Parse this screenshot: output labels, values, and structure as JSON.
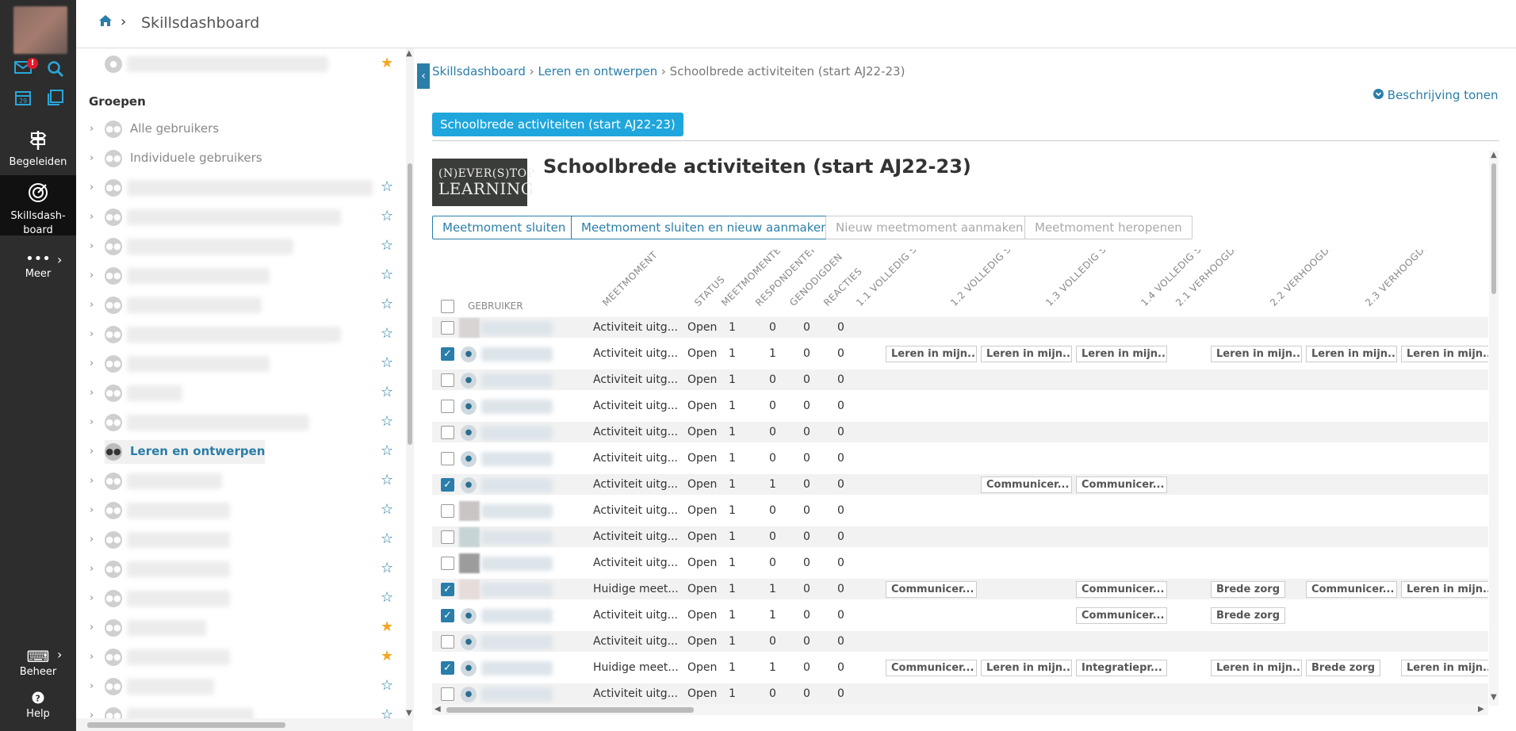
{
  "topbar": {
    "title": "Skillsdashboard"
  },
  "rail": {
    "badge": "!",
    "begeleiden": "Begeleiden",
    "skillsdashboard_1": "Skillsdash-",
    "skillsdashboard_2": "board",
    "meer": "Meer",
    "beheer": "Beheer",
    "help": "Help"
  },
  "groups": {
    "header": "Groepen",
    "items": [
      {
        "label": "Alle gebruikers"
      },
      {
        "label": "Individuele gebruikers"
      },
      {
        "label": "Leren en ontwerpen"
      }
    ]
  },
  "breadcrumb": {
    "item1": "Skillsdashboard",
    "item2": "Leren en ontwerpen",
    "current": "Schoolbrede activiteiten (start AJ22-23)"
  },
  "description_link": "Beschrijving tonen",
  "activity_pill": "Schoolbrede activiteiten (start AJ22-23)",
  "image_text": {
    "line1": "(N)EVER(S)TOP",
    "line2": "LEARNING"
  },
  "heading": "Schoolbrede activiteiten (start AJ22-23)",
  "buttons": {
    "close": "Meetmoment sluiten",
    "close_new": "Meetmoment sluiten en nieuw aanmaken",
    "new": "Nieuw meetmoment aanmaken",
    "reopen": "Meetmoment heropenen"
  },
  "table": {
    "user_header": "GEBRUIKER",
    "columns": [
      "MEETMOMENT",
      "STATUS",
      "MEETMOMENTEN",
      "RESPONDENTEN",
      "GENODIGDEN",
      "REACTIES",
      "1.1 VOLLEDIG SCH...",
      "1.2 VOLLEDIG SCH...",
      "1.3 VOLLEDIG SCH...",
      "1.4 VOLLEDIG SCH...",
      "2.1 VERHOOGDE Z...",
      "2.2 VERHOOGDE Z...",
      "2.3 VERHOOGDE Z..."
    ],
    "rows": [
      {
        "checked": false,
        "meetmoment": "Activiteit uitg...",
        "status": "Open",
        "m": "1",
        "r": "0",
        "g": "0",
        "re": "0",
        "tags": []
      },
      {
        "checked": true,
        "meetmoment": "Activiteit uitg...",
        "status": "Open",
        "m": "1",
        "r": "1",
        "g": "0",
        "re": "0",
        "tags": [
          "Leren in mijn...",
          "Leren in mijn...",
          "Leren in mijn...",
          "",
          "Leren in mijn...",
          "Leren in mijn...",
          "Leren in mijn..."
        ]
      },
      {
        "checked": false,
        "meetmoment": "Activiteit uitg...",
        "status": "Open",
        "m": "1",
        "r": "0",
        "g": "0",
        "re": "0",
        "tags": []
      },
      {
        "checked": false,
        "meetmoment": "Activiteit uitg...",
        "status": "Open",
        "m": "1",
        "r": "0",
        "g": "0",
        "re": "0",
        "tags": []
      },
      {
        "checked": false,
        "meetmoment": "Activiteit uitg...",
        "status": "Open",
        "m": "1",
        "r": "0",
        "g": "0",
        "re": "0",
        "tags": []
      },
      {
        "checked": false,
        "meetmoment": "Activiteit uitg...",
        "status": "Open",
        "m": "1",
        "r": "0",
        "g": "0",
        "re": "0",
        "tags": []
      },
      {
        "checked": true,
        "meetmoment": "Activiteit uitg...",
        "status": "Open",
        "m": "1",
        "r": "1",
        "g": "0",
        "re": "0",
        "tags": [
          "",
          "Communicer...",
          "Communicer...",
          "",
          "",
          "",
          ""
        ]
      },
      {
        "checked": false,
        "meetmoment": "Activiteit uitg...",
        "status": "Open",
        "m": "1",
        "r": "0",
        "g": "0",
        "re": "0",
        "tags": []
      },
      {
        "checked": false,
        "meetmoment": "Activiteit uitg...",
        "status": "Open",
        "m": "1",
        "r": "0",
        "g": "0",
        "re": "0",
        "tags": []
      },
      {
        "checked": false,
        "meetmoment": "Activiteit uitg...",
        "status": "Open",
        "m": "1",
        "r": "0",
        "g": "0",
        "re": "0",
        "tags": []
      },
      {
        "checked": true,
        "meetmoment": "Huidige meet...",
        "status": "Open",
        "m": "1",
        "r": "1",
        "g": "0",
        "re": "0",
        "tags": [
          "Communicer...",
          "",
          "Communicer...",
          "",
          "Brede zorg",
          "Communicer...",
          "Leren in mijn..."
        ]
      },
      {
        "checked": true,
        "meetmoment": "Activiteit uitg...",
        "status": "Open",
        "m": "1",
        "r": "1",
        "g": "0",
        "re": "0",
        "tags": [
          "",
          "",
          "Communicer...",
          "",
          "Brede zorg",
          "",
          ""
        ]
      },
      {
        "checked": false,
        "meetmoment": "Activiteit uitg...",
        "status": "Open",
        "m": "1",
        "r": "0",
        "g": "0",
        "re": "0",
        "tags": []
      },
      {
        "checked": true,
        "meetmoment": "Huidige meet...",
        "status": "Open",
        "m": "1",
        "r": "1",
        "g": "0",
        "re": "0",
        "tags": [
          "Communicer...",
          "Leren in mijn...",
          "Integratiepr...",
          "",
          "Leren in mijn...",
          "Brede zorg",
          "Leren in mijn..."
        ]
      },
      {
        "checked": false,
        "meetmoment": "Activiteit uitg...",
        "status": "Open",
        "m": "1",
        "r": "0",
        "g": "0",
        "re": "0",
        "tags": []
      }
    ]
  }
}
